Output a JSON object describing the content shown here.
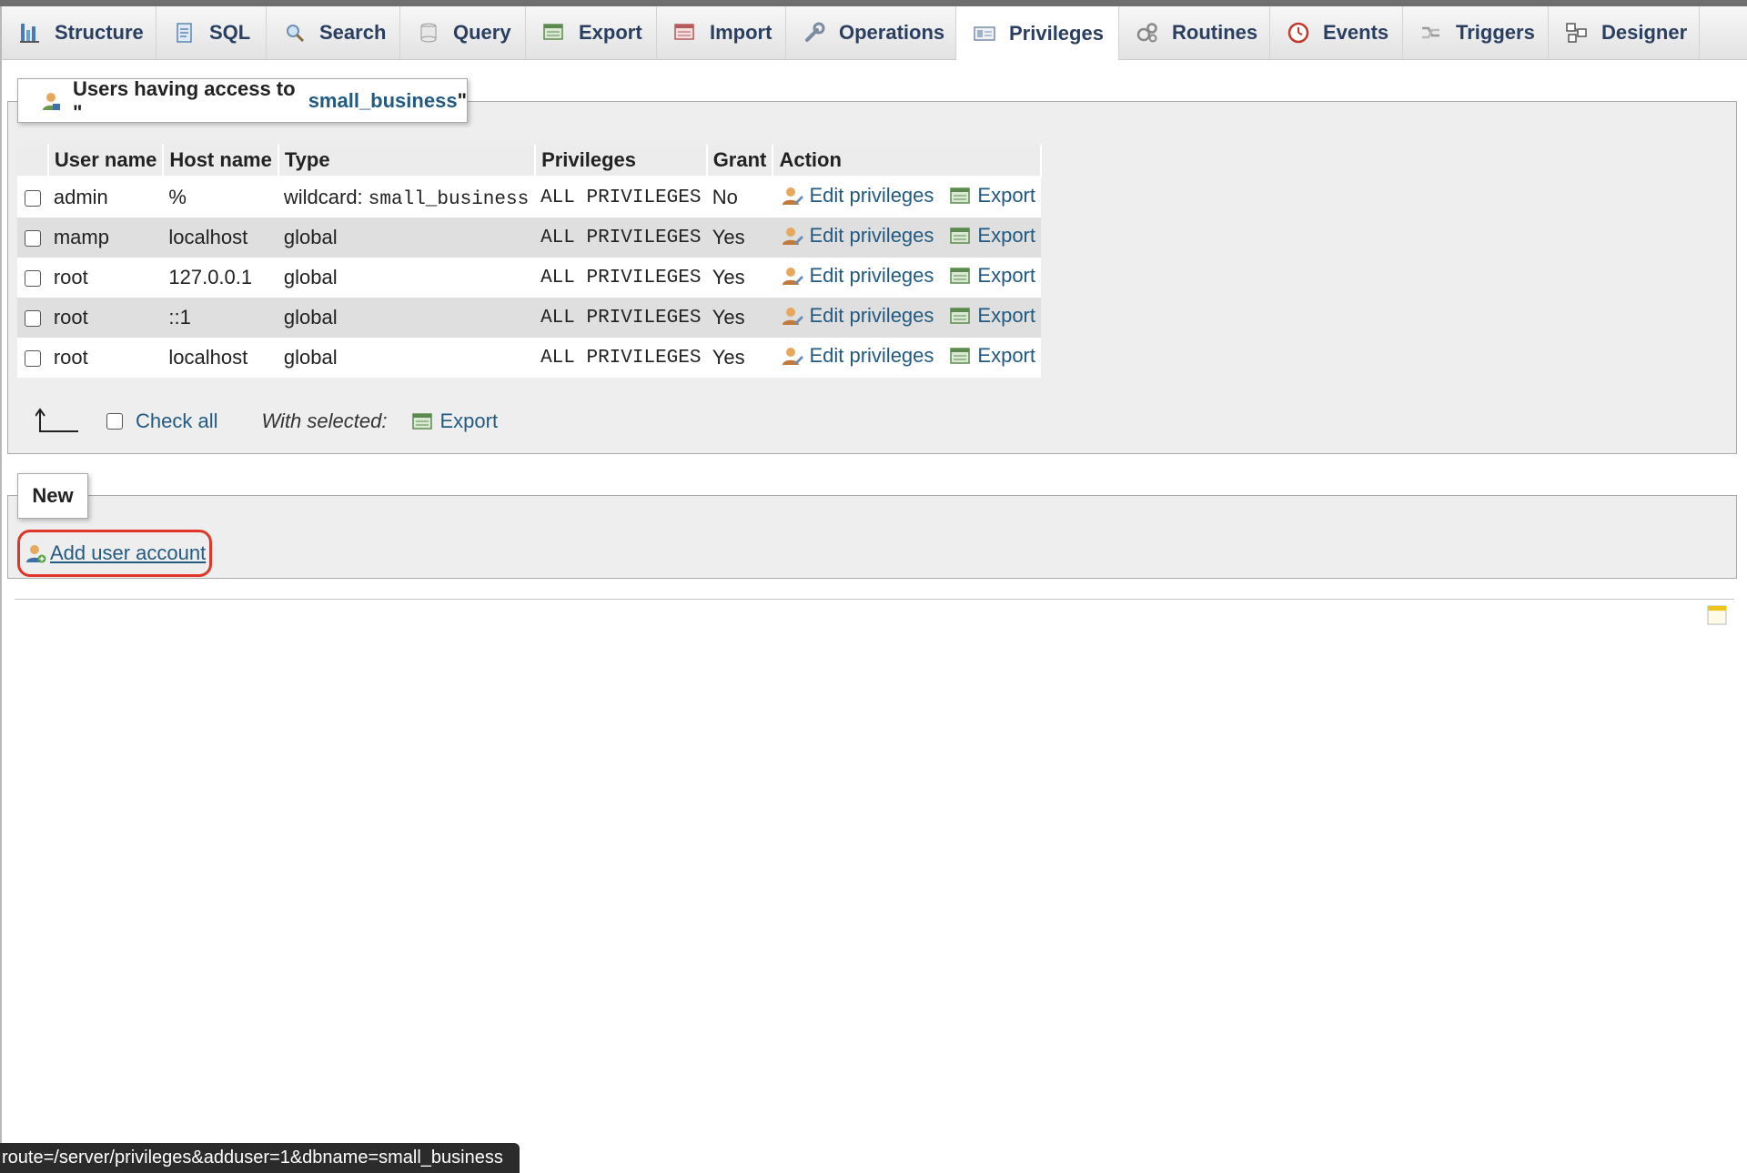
{
  "tabs": [
    {
      "label": "Structure",
      "icon": "structure-icon"
    },
    {
      "label": "SQL",
      "icon": "sql-icon"
    },
    {
      "label": "Search",
      "icon": "search-icon"
    },
    {
      "label": "Query",
      "icon": "query-icon"
    },
    {
      "label": "Export",
      "icon": "export-icon"
    },
    {
      "label": "Import",
      "icon": "import-icon"
    },
    {
      "label": "Operations",
      "icon": "wrench-icon"
    },
    {
      "label": "Privileges",
      "icon": "privileges-icon",
      "active": true
    },
    {
      "label": "Routines",
      "icon": "routines-icon"
    },
    {
      "label": "Events",
      "icon": "clock-icon"
    },
    {
      "label": "Triggers",
      "icon": "triggers-icon"
    },
    {
      "label": "Designer",
      "icon": "designer-icon"
    }
  ],
  "users_section": {
    "legend_prefix": "Users having access to \"",
    "db_name": "small_business",
    "legend_suffix": "\"",
    "headers": [
      "User name",
      "Host name",
      "Type",
      "Privileges",
      "Grant",
      "Action"
    ],
    "rows": [
      {
        "user": "admin",
        "host": "%",
        "type_prefix": "wildcard: ",
        "type_mono": "small_business",
        "privileges": "ALL PRIVILEGES",
        "grant": "No"
      },
      {
        "user": "mamp",
        "host": "localhost",
        "type_prefix": "global",
        "type_mono": "",
        "privileges": "ALL PRIVILEGES",
        "grant": "Yes"
      },
      {
        "user": "root",
        "host": "127.0.0.1",
        "type_prefix": "global",
        "type_mono": "",
        "privileges": "ALL PRIVILEGES",
        "grant": "Yes"
      },
      {
        "user": "root",
        "host": "::1",
        "type_prefix": "global",
        "type_mono": "",
        "privileges": "ALL PRIVILEGES",
        "grant": "Yes"
      },
      {
        "user": "root",
        "host": "localhost",
        "type_prefix": "global",
        "type_mono": "",
        "privileges": "ALL PRIVILEGES",
        "grant": "Yes"
      }
    ],
    "edit_label": "Edit privileges",
    "export_label": "Export",
    "check_all_label": "Check all",
    "with_selected_label": "With selected:",
    "bulk_export_label": "Export"
  },
  "new_section": {
    "legend": "New",
    "add_user_label": "Add user account"
  },
  "status_bar": {
    "url": "route=/server/privileges&adduser=1&dbname=small_business"
  },
  "colors": {
    "link": "#235a81",
    "highlight": "#e0352b"
  }
}
